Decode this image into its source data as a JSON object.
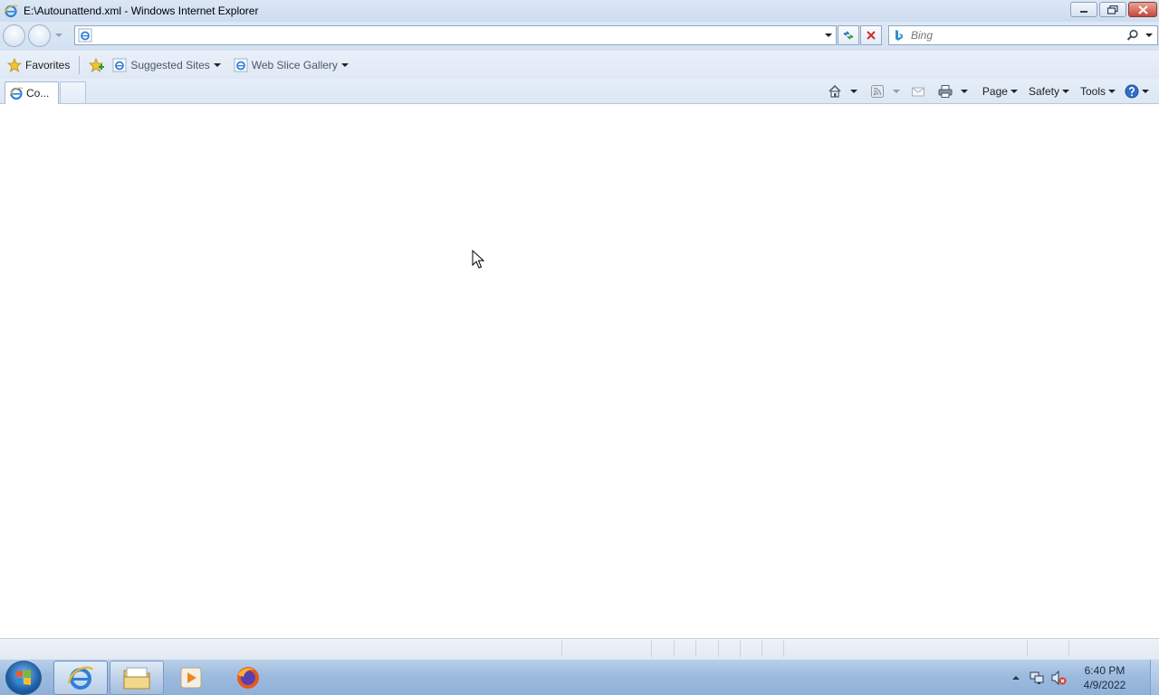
{
  "window": {
    "title": "E:\\Autounattend.xml - Windows Internet Explorer"
  },
  "navigation": {
    "address_value": "",
    "search_placeholder": "Bing"
  },
  "favorites_bar": {
    "favorites_label": "Favorites",
    "suggested_sites_label": "Suggested Sites",
    "web_slice_gallery_label": "Web Slice Gallery"
  },
  "tabs": [
    {
      "label": "Co..."
    }
  ],
  "command_bar": {
    "page_label": "Page",
    "safety_label": "Safety",
    "tools_label": "Tools"
  },
  "taskbar": {
    "items": [
      {
        "name": "internet-explorer",
        "active": true
      },
      {
        "name": "windows-explorer",
        "active": false
      },
      {
        "name": "media-player",
        "active": false
      },
      {
        "name": "firefox",
        "active": false
      }
    ],
    "clock_time": "6:40 PM",
    "clock_date": "4/9/2022"
  },
  "colors": {
    "chrome_blue": "#dbe7f5",
    "close_red": "#c8473b",
    "taskbar_blue": "#9dbbde"
  }
}
